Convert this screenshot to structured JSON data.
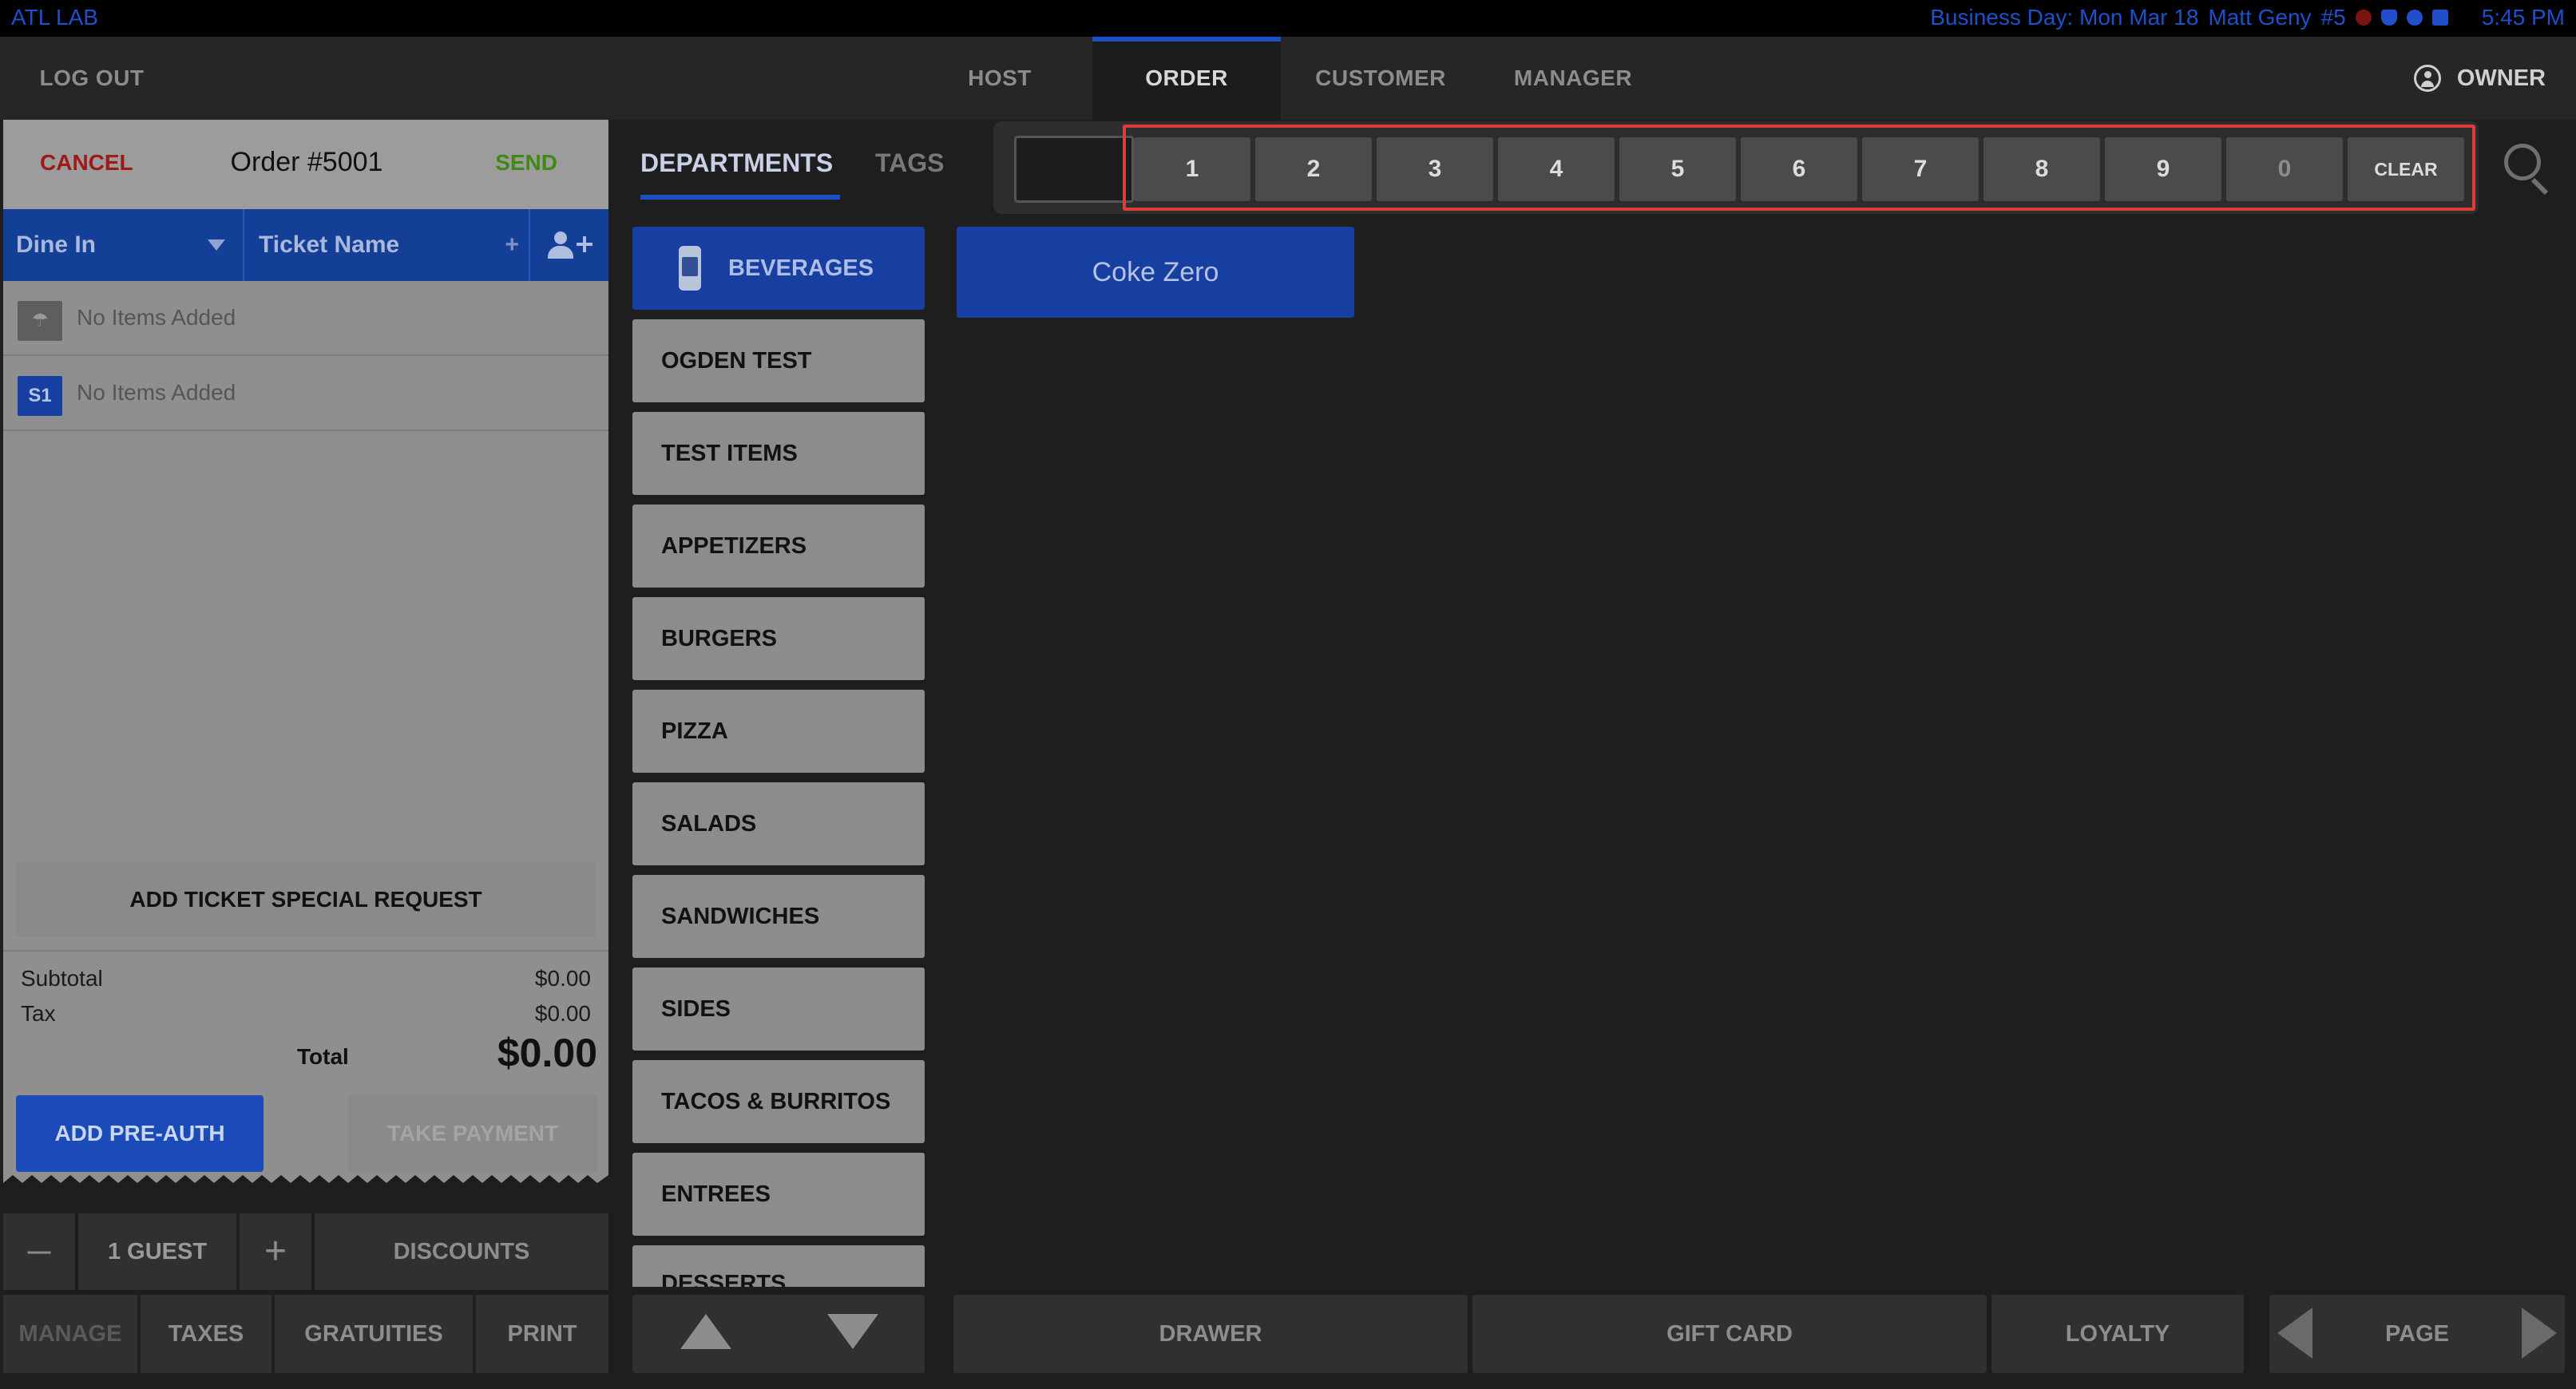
{
  "status_bar": {
    "left_label": "ATL LAB",
    "business_day": "Business Day: Mon Mar 18",
    "user": "Matt Geny",
    "terminal": "#5",
    "time": "5:45 PM"
  },
  "top_nav": {
    "logout": "LOG OUT",
    "tabs": [
      "HOST",
      "ORDER",
      "CUSTOMER",
      "MANAGER"
    ],
    "active_tab": "ORDER",
    "account": "OWNER"
  },
  "ticket": {
    "cancel": "CANCEL",
    "title": "Order #5001",
    "send": "SEND",
    "order_type": "Dine In",
    "ticket_name": "Ticket Name",
    "ticket_name_plus": "+",
    "seats": [
      {
        "badge": "",
        "text": "No Items Added"
      },
      {
        "badge": "S1",
        "text": "No Items Added"
      }
    ],
    "special_request": "ADD TICKET SPECIAL REQUEST",
    "subtotal_label": "Subtotal",
    "subtotal_value": "$0.00",
    "tax_label": "Tax",
    "tax_value": "$0.00",
    "total_label": "Total",
    "total_value": "$0.00",
    "preauth": "ADD PRE-AUTH",
    "take_payment": "TAKE PAYMENT"
  },
  "guest_bar": {
    "minus": "—",
    "guests": "1 GUEST",
    "plus": "+",
    "discounts": "DISCOUNTS"
  },
  "action_bar": {
    "manage": "MANAGE",
    "taxes": "TAXES",
    "gratuities": "GRATUITIES",
    "print": "PRINT"
  },
  "categories": {
    "tab_departments": "DEPARTMENTS",
    "tab_tags": "TAGS",
    "items": [
      "BEVERAGES",
      "OGDEN TEST",
      "TEST ITEMS",
      "APPETIZERS",
      "BURGERS",
      "PIZZA",
      "SALADS",
      "SANDWICHES",
      "SIDES",
      "TACOS & BURRITOS",
      "ENTREES",
      "DESSERTS"
    ],
    "active": "BEVERAGES"
  },
  "keypad": {
    "keys": [
      "1",
      "2",
      "3",
      "4",
      "5",
      "6",
      "7",
      "8",
      "9",
      "0"
    ],
    "clear": "CLEAR",
    "display_value": ""
  },
  "menu_items": [
    {
      "label": "Coke Zero"
    }
  ],
  "bottom_bar": {
    "drawer": "DRAWER",
    "gift_card": "GIFT CARD",
    "loyalty": "LOYALTY",
    "page": "PAGE"
  },
  "colors": {
    "accent_blue": "#1a4fc6",
    "cancel_red": "#a01818",
    "send_green": "#3f8a14",
    "highlight_red": "#e03b3b"
  }
}
